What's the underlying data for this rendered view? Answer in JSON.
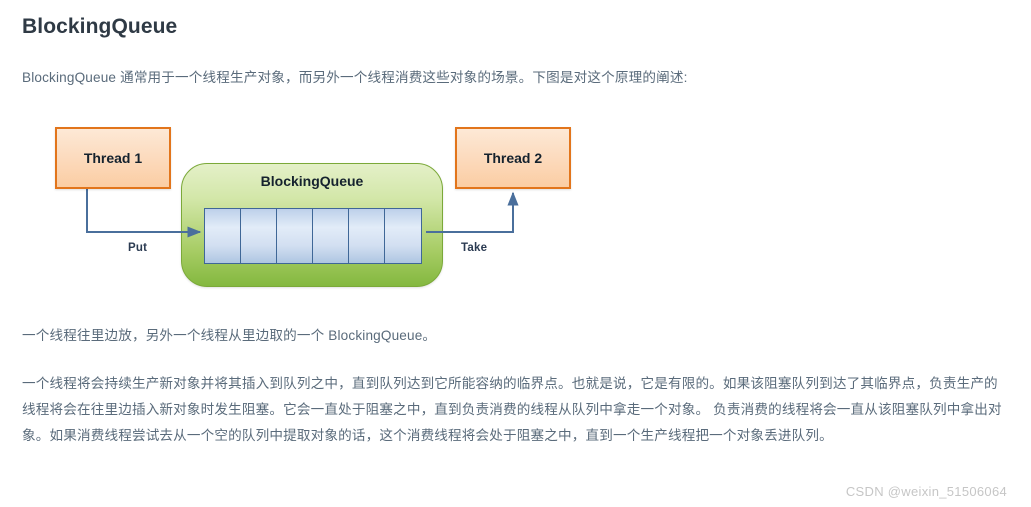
{
  "article": {
    "title": "BlockingQueue",
    "intro": "BlockingQueue 通常用于一个线程生产对象，而另外一个线程消费这些对象的场景。下图是对这个原理的阐述:",
    "summary": "一个线程往里边放，另外一个线程从里边取的一个 BlockingQueue。",
    "detail": "一个线程将会持续生产新对象并将其插入到队列之中，直到队列达到它所能容纳的临界点。也就是说，它是有限的。如果该阻塞队列到达了其临界点，负责生产的线程将会在往里边插入新对象时发生阻塞。它会一直处于阻塞之中，直到负责消费的线程从队列中拿走一个对象。 负责消费的线程将会一直从该阻塞队列中拿出对象。如果消费线程尝试去从一个空的队列中提取对象的话，这个消费线程将会处于阻塞之中，直到一个生产线程把一个对象丢进队列。"
  },
  "figure": {
    "producer_label": "Thread 1",
    "consumer_label": "Thread 2",
    "queue_label": "BlockingQueue",
    "put_label": "Put",
    "take_label": "Take",
    "cell_count": 6,
    "colors": {
      "thread_border": "#e2751b",
      "thread_fill": "#fcdcc0",
      "queue_border": "#7ba939",
      "queue_fill": "#a8cd66",
      "cell_border": "#3f6797",
      "cell_fill": "#cfdcf0",
      "arrow": "#4a6f9c"
    }
  },
  "watermark": "CSDN @weixin_51506064"
}
